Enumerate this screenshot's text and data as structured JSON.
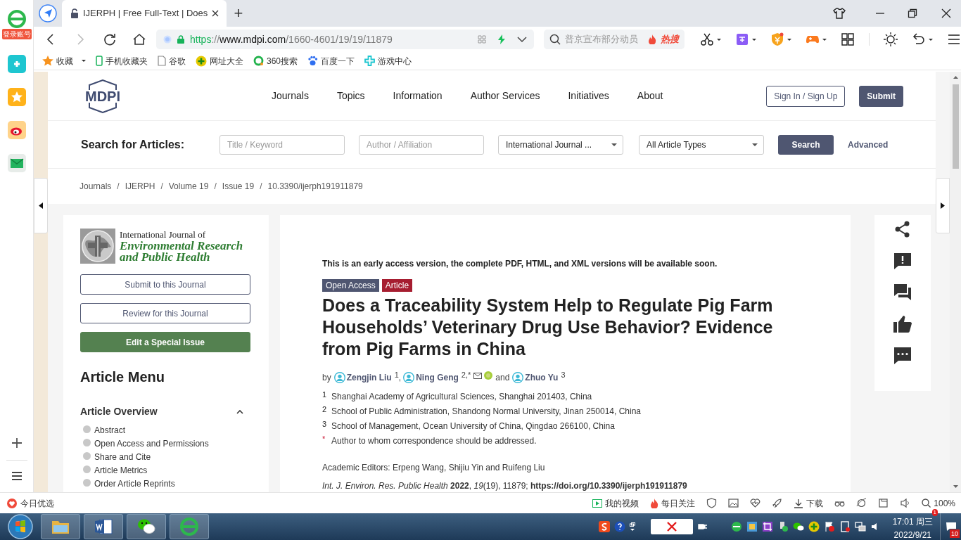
{
  "browser": {
    "sidebar_badge": "登录账号",
    "tab": {
      "title": "IJERPH | Free Full-Text | Does"
    },
    "new_tab": "+",
    "address": {
      "scheme": "https",
      "separator": "://",
      "domain": "www.mdpi.com",
      "path": "/1660-4601/19/19/11879"
    },
    "search": {
      "placeholder": "普京宣布部分动员",
      "hot": "热搜"
    },
    "bookmarks": [
      {
        "kind": "star",
        "label": "收藏"
      },
      {
        "kind": "phone",
        "label": "手机收藏夹"
      },
      {
        "kind": "page",
        "label": "谷歌"
      },
      {
        "kind": "plus",
        "label": "网址大全"
      },
      {
        "kind": "ring",
        "label": "360搜索"
      },
      {
        "kind": "paw",
        "label": "百度一下"
      },
      {
        "kind": "game",
        "label": "游戏中心"
      }
    ]
  },
  "page": {
    "nav": [
      "Journals",
      "Topics",
      "Information",
      "Author Services",
      "Initiatives",
      "About"
    ],
    "sign_in": "Sign In / Sign Up",
    "submit": "Submit",
    "search": {
      "label": "Search for Articles:",
      "fields": [
        {
          "placeholder": "Title / Keyword"
        },
        {
          "placeholder": "Author / Affiliation"
        }
      ],
      "selects": [
        "International Journal ...",
        "All Article Types"
      ],
      "button": "Search",
      "advanced": "Advanced"
    },
    "logo": "MDPI",
    "breadcrumb_separator": "/",
    "breadcrumb": [
      "Journals",
      "IJERPH",
      "Volume 19",
      "Issue 19",
      "10.3390/ijerph191911879"
    ],
    "journal": {
      "line1": "International Journal of",
      "line2": "Environmental Research",
      "line3": "and Public Health"
    },
    "sidebar_buttons": [
      {
        "kind": "outline",
        "label": "Submit to this Journal"
      },
      {
        "kind": "outline",
        "label": "Review for this Journal"
      },
      {
        "kind": "filled",
        "label": "Edit a Special Issue"
      }
    ],
    "article_menu": {
      "title": "Article Menu",
      "section": {
        "title": "Article Overview",
        "expanded": true,
        "items": [
          "Abstract",
          "Open Access and Permissions",
          "Share and Cite",
          "Article Metrics",
          "Order Article Reprints"
        ]
      }
    },
    "article": {
      "notice": "This is an early access version, the complete PDF, HTML, and XML versions will be available soon.",
      "badges": [
        {
          "label": "Open Access",
          "color": "#4f5671"
        },
        {
          "label": "Article",
          "color": "#a61d30"
        }
      ],
      "title": "Does a Traceability System Help to Regulate Pig Farm Households’ Veterinary Drug Use Behavior? Evidence from Pig Farms in China",
      "authors": [
        {
          "before": "by",
          "name": "Zengjin Liu",
          "sup": "1",
          "contact": false
        },
        {
          "before": ",",
          "name": "Ning Geng",
          "sup": "2,*",
          "contact": true
        },
        {
          "before": "and",
          "name": "Zhuo Yu",
          "sup": "3",
          "contact": false
        }
      ],
      "affiliations": [
        {
          "mark": "1",
          "text": "Shanghai Academy of Agricultural Sciences, Shanghai 201403, China"
        },
        {
          "mark": "2",
          "text": "School of Public Administration, Shandong Normal University, Jinan 250014, China"
        },
        {
          "mark": "3",
          "text": "School of Management, Ocean University of China, Qingdao 266100, China"
        },
        {
          "mark": "*",
          "text": "Author to whom correspondence should be addressed."
        }
      ],
      "editors": "Academic Editors: Erpeng Wang, Shijiu Yin and Ruifeng Liu",
      "citation": "*Int. J. Environ. Res. Public Health* **2022**, *19*(19), 11879; **https://doi.org/10.3390/ijerph191911879**"
    }
  },
  "status_bar": {
    "left": "今日优选",
    "items": [
      {
        "kind": "video",
        "label": "我的视频"
      },
      {
        "kind": "fire",
        "label": "每日关注"
      },
      {
        "kind": "download",
        "label": "下载"
      },
      {
        "kind": "zoom",
        "label": "100%"
      }
    ]
  },
  "taskbar": {
    "time": "17:01 周三",
    "date": "2022/9/21",
    "notification_count": "10",
    "tray_badge": "1"
  }
}
